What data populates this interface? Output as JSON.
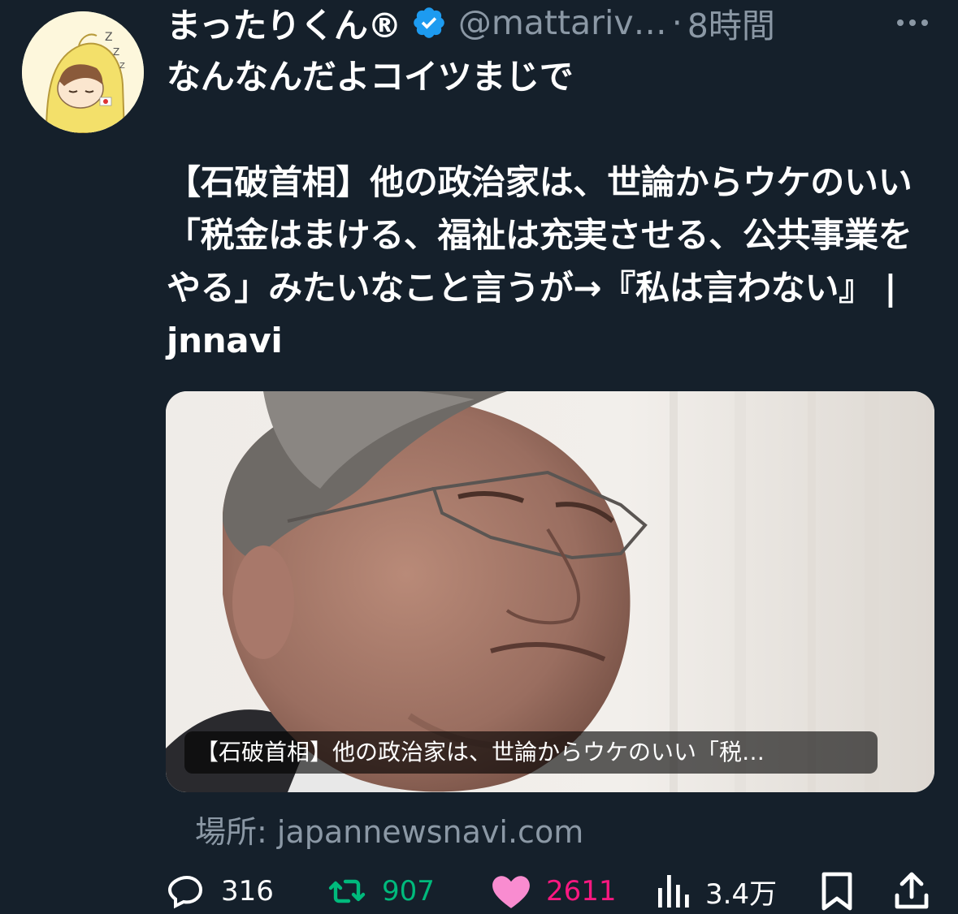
{
  "tweet": {
    "display_name": "まったりくん®",
    "handle": "@mattariv…",
    "separator": "·",
    "time": "8時間",
    "text": "なんなんだよコイツまじで\n\n【石破首相】他の政治家は、世論からウケのいい「税金はまける、福祉は充実させる、公共事業をやる」みたいなこと言うが→『私は言わない』 | jnnavi"
  },
  "card": {
    "caption": "【石破首相】他の政治家は、世論からウケのいい「税…",
    "source": "場所: japannewsnavi.com"
  },
  "actions": {
    "reply_count": "316",
    "retweet_count": "907",
    "like_count": "2611",
    "view_count": "3.4万"
  },
  "colors": {
    "background": "#15202b",
    "verified": "#1d9bf0",
    "retweet": "#00ba7c",
    "like": "#f91880",
    "secondary_text": "#8b98a5"
  },
  "icons": {
    "verified": "verified-badge-icon",
    "more": "more-dots-icon",
    "reply": "reply-icon",
    "retweet": "retweet-icon",
    "like": "heart-icon",
    "views": "views-bars-icon",
    "bookmark": "bookmark-icon",
    "share": "share-icon"
  }
}
